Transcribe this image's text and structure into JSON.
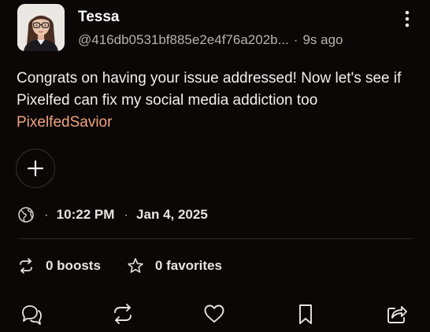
{
  "post": {
    "author": {
      "display_name": "Tessa",
      "handle": "@416db0531bf885e2e4f76a202b...",
      "time_ago": "9s ago"
    },
    "text": "Congrats on having your issue addressed! Now let's see if Pixelfed can fix my social media addiction too",
    "hashtag": "PixelfedSavior",
    "visibility_icon": "globe-icon",
    "time": "10:22 PM",
    "date": "Jan 4, 2025",
    "separator": "·",
    "boosts_label": "0 boosts",
    "favorites_label": "0 favorites"
  },
  "actions": [
    "reply-icon",
    "boost-icon",
    "heart-icon",
    "bookmark-icon",
    "share-icon"
  ],
  "colors": {
    "background": "#0b0707",
    "hashtag": "#f0a47e",
    "secondary_text": "#b8b1ad",
    "divider": "#2c2523"
  }
}
